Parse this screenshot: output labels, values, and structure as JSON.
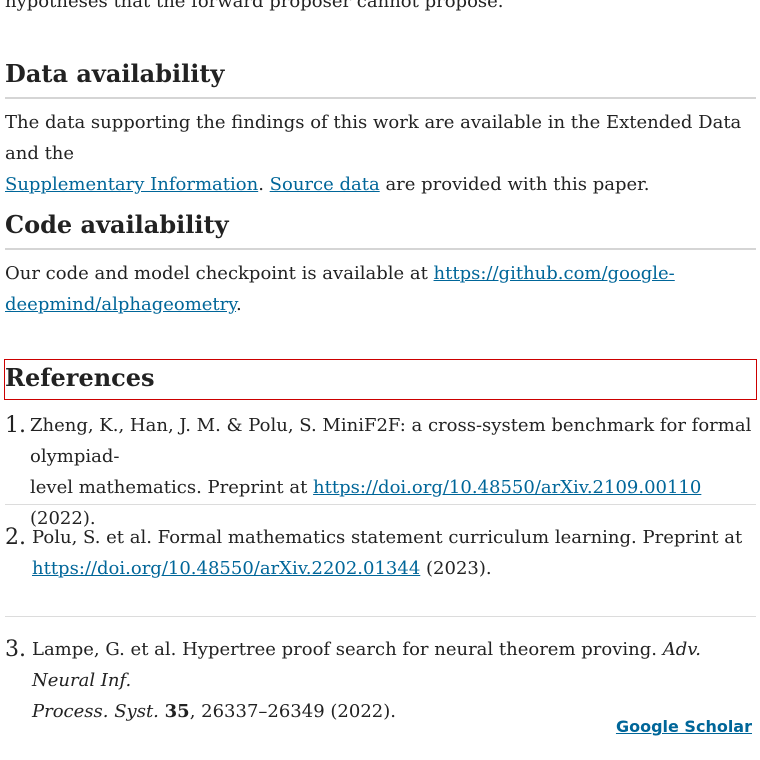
{
  "intro": {
    "tail_text": "hypotheses that the forward proposer cannot propose."
  },
  "data_availability": {
    "title": "Data availability",
    "text_1": "The data supporting the findings of this work are available in the Extended Data and the",
    "link_1": "Supplementary Information",
    "text_2": ".",
    "link_2": "Source data",
    "text_3": "are provided with this paper."
  },
  "code_availability": {
    "title": "Code availability",
    "text_1": "Our code and model checkpoint is available at",
    "link_line_1": "https://github.com/google-",
    "link_line_2": "deepmind/alphageometry",
    "text_2": "."
  },
  "references": {
    "title": "References",
    "items": [
      {
        "num": "1.",
        "line_1": "Zheng, K., Han, J. M. & Polu, S. MiniF2F: a cross-system benchmark for formal olympiad-",
        "line_2_text": "level mathematics. Preprint at",
        "link": "https://doi.org/10.48550/arXiv.2109.00110",
        "year": "(2022)."
      },
      {
        "num": "2.",
        "line_1": "Polu, S. et al. Formal mathematics statement curriculum learning. Preprint at",
        "link": "https://doi.org/10.48550/arXiv.2202.01344",
        "year": "(2023)."
      },
      {
        "num": "3.",
        "line_1_text": "Lampe, G. et al. Hypertree proof search for neural theorem proving.",
        "line_1_italic": "Adv. Neural Inf.",
        "line_2_italic": "Process. Syst.",
        "volume": "35",
        "pages_year": ", 26337–26349 (2022)."
      }
    ],
    "scholar_link": "Google Scholar"
  },
  "colors": {
    "link": "#006699",
    "text": "#222222",
    "highlight_border": "#cc0000",
    "rule": "#d5d5d5"
  }
}
